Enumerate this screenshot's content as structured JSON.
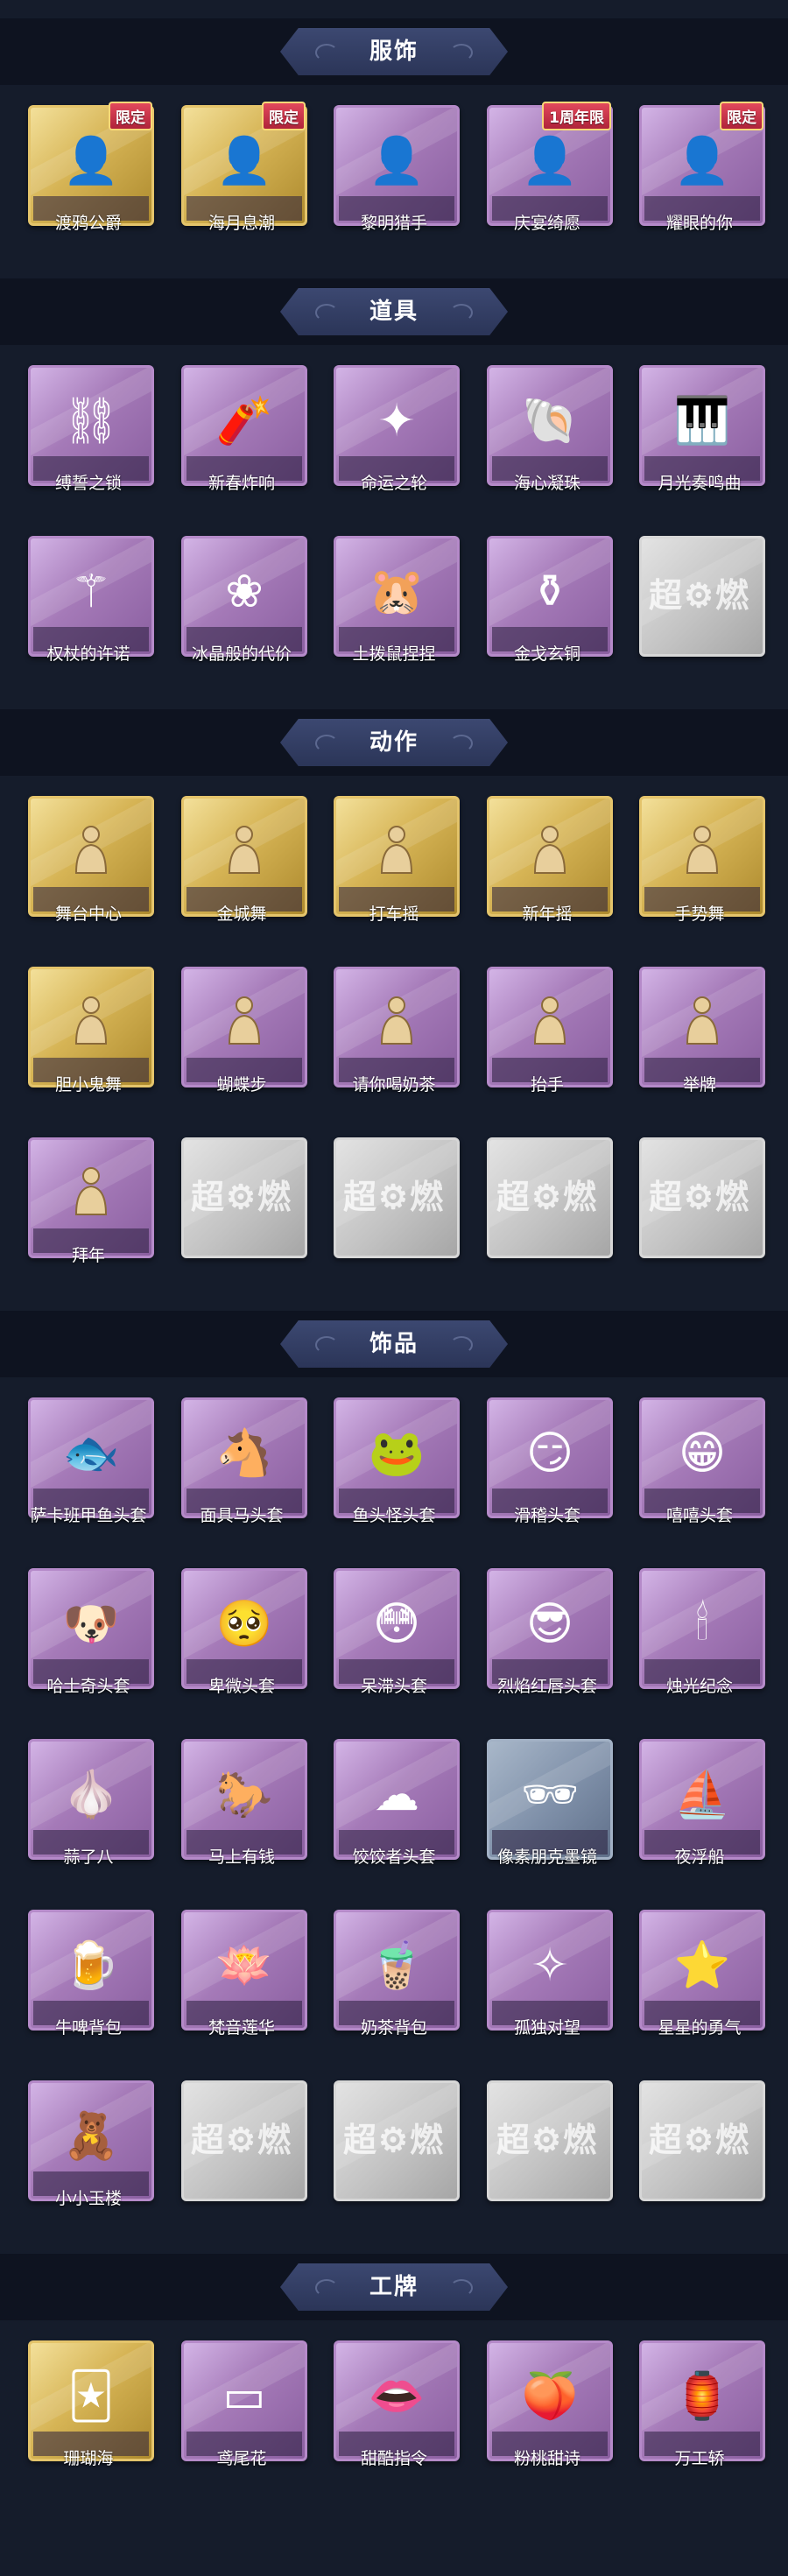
{
  "sections": [
    {
      "title": "服饰",
      "items": [
        {
          "label": "渡鸦公爵",
          "badge": "限定",
          "tier": "gold",
          "icon": "portrait-icon",
          "glyph": "👤"
        },
        {
          "label": "海月息潮",
          "badge": "限定",
          "tier": "gold",
          "icon": "portrait-icon",
          "glyph": "👤"
        },
        {
          "label": "黎明猎手",
          "badge": "",
          "tier": "purple",
          "icon": "portrait-icon",
          "glyph": "👤"
        },
        {
          "label": "庆宴绮愿",
          "badge": "1周年限",
          "tier": "purple",
          "icon": "portrait-icon",
          "glyph": "👤"
        },
        {
          "label": "耀眼的你",
          "badge": "限定",
          "tier": "purple",
          "icon": "portrait-icon",
          "glyph": "👤"
        }
      ]
    },
    {
      "title": "道具",
      "items": [
        {
          "label": "缚誓之锁",
          "badge": "",
          "tier": "purple",
          "icon": "chain-icon",
          "glyph": "⛓"
        },
        {
          "label": "新春炸响",
          "badge": "",
          "tier": "purple",
          "icon": "firecracker-icon",
          "glyph": "🧨"
        },
        {
          "label": "命运之轮",
          "badge": "",
          "tier": "purple",
          "icon": "wheel-icon",
          "glyph": "✦"
        },
        {
          "label": "海心凝珠",
          "badge": "",
          "tier": "purple",
          "icon": "pearl-icon",
          "glyph": "🐚"
        },
        {
          "label": "月光奏鸣曲",
          "badge": "",
          "tier": "purple",
          "icon": "piano-icon",
          "glyph": "🎹"
        },
        {
          "label": "权杖的许诺",
          "badge": "",
          "tier": "purple",
          "icon": "scepter-icon",
          "glyph": "⚚"
        },
        {
          "label": "冰晶般的代价",
          "badge": "",
          "tier": "purple",
          "icon": "lotus-icon",
          "glyph": "❀"
        },
        {
          "label": "土拨鼠捏捏",
          "badge": "",
          "tier": "purple",
          "icon": "hamster-icon",
          "glyph": "🐹"
        },
        {
          "label": "金戈玄铜",
          "badge": "",
          "tier": "purple",
          "icon": "bronze-icon",
          "glyph": "⚱"
        },
        {
          "label": "",
          "badge": "",
          "tier": "gray",
          "icon": "placeholder-icon",
          "glyph": ""
        }
      ]
    },
    {
      "title": "动作",
      "items": [
        {
          "label": "舞台中心",
          "badge": "",
          "tier": "gold",
          "icon": "gesture-icon",
          "glyph": ""
        },
        {
          "label": "金城舞",
          "badge": "",
          "tier": "gold",
          "icon": "gesture-icon",
          "glyph": ""
        },
        {
          "label": "打车摇",
          "badge": "",
          "tier": "gold",
          "icon": "gesture-icon",
          "glyph": ""
        },
        {
          "label": "新年摇",
          "badge": "",
          "tier": "gold",
          "icon": "gesture-icon",
          "glyph": ""
        },
        {
          "label": "手势舞",
          "badge": "",
          "tier": "gold",
          "icon": "gesture-icon",
          "glyph": ""
        },
        {
          "label": "胆小鬼舞",
          "badge": "",
          "tier": "gold",
          "icon": "gesture-icon",
          "glyph": ""
        },
        {
          "label": "蝴蝶步",
          "badge": "",
          "tier": "purple",
          "icon": "gesture-icon",
          "glyph": ""
        },
        {
          "label": "请你喝奶茶",
          "badge": "",
          "tier": "purple",
          "icon": "gesture-icon",
          "glyph": ""
        },
        {
          "label": "抬手",
          "badge": "",
          "tier": "purple",
          "icon": "gesture-icon",
          "glyph": ""
        },
        {
          "label": "举牌",
          "badge": "",
          "tier": "purple",
          "icon": "gesture-icon",
          "glyph": ""
        },
        {
          "label": "拜年",
          "badge": "",
          "tier": "purple",
          "icon": "gesture-icon",
          "glyph": ""
        },
        {
          "label": "",
          "badge": "",
          "tier": "gray",
          "icon": "placeholder-icon",
          "glyph": ""
        },
        {
          "label": "",
          "badge": "",
          "tier": "gray",
          "icon": "placeholder-icon",
          "glyph": ""
        },
        {
          "label": "",
          "badge": "",
          "tier": "gray",
          "icon": "placeholder-icon",
          "glyph": ""
        },
        {
          "label": "",
          "badge": "",
          "tier": "gray",
          "icon": "placeholder-icon",
          "glyph": ""
        }
      ]
    },
    {
      "title": "饰品",
      "items": [
        {
          "label": "萨卡班甲鱼头套",
          "badge": "",
          "tier": "purple",
          "icon": "fish-mask-icon",
          "glyph": "🐟"
        },
        {
          "label": "面具马头套",
          "badge": "",
          "tier": "purple",
          "icon": "horse-mask-icon",
          "glyph": "🐴"
        },
        {
          "label": "鱼头怪头套",
          "badge": "",
          "tier": "purple",
          "icon": "fish-monster-icon",
          "glyph": "🐸"
        },
        {
          "label": "滑稽头套",
          "badge": "",
          "tier": "purple",
          "icon": "smirk-face-icon",
          "glyph": "😏"
        },
        {
          "label": "嘻嘻头套",
          "badge": "",
          "tier": "purple",
          "icon": "grin-face-icon",
          "glyph": "😁"
        },
        {
          "label": "哈士奇头套",
          "badge": "",
          "tier": "purple",
          "icon": "dog-mask-icon",
          "glyph": "🐶"
        },
        {
          "label": "卑微头套",
          "badge": "",
          "tier": "purple",
          "icon": "sad-face-icon",
          "glyph": "🥺"
        },
        {
          "label": "呆滞头套",
          "badge": "",
          "tier": "purple",
          "icon": "blank-face-icon",
          "glyph": "😳"
        },
        {
          "label": "烈焰红唇头套",
          "badge": "",
          "tier": "purple",
          "icon": "pikachu-mask-icon",
          "glyph": "😎"
        },
        {
          "label": "烛光纪念",
          "badge": "",
          "tier": "purple",
          "icon": "candle-icon",
          "glyph": "🕯"
        },
        {
          "label": "蒜了八",
          "badge": "",
          "tier": "purple",
          "icon": "garlic-icon",
          "glyph": "🧄"
        },
        {
          "label": "马上有钱",
          "badge": "",
          "tier": "purple",
          "icon": "horse-toy-icon",
          "glyph": "🐎"
        },
        {
          "label": "饺饺者头套",
          "badge": "",
          "tier": "purple",
          "icon": "dumpling-icon",
          "glyph": "☁"
        },
        {
          "label": "像素朋克墨镜",
          "badge": "",
          "tier": "blue",
          "icon": "sunglasses-icon",
          "glyph": "🕶"
        },
        {
          "label": "夜浮船",
          "badge": "",
          "tier": "purple",
          "icon": "ghost-ship-icon",
          "glyph": "⛵"
        },
        {
          "label": "牛啤背包",
          "badge": "",
          "tier": "purple",
          "icon": "beer-backpack-icon",
          "glyph": "🍺"
        },
        {
          "label": "梵音莲华",
          "badge": "",
          "tier": "purple",
          "icon": "charm-icon",
          "glyph": "🪷"
        },
        {
          "label": "奶茶背包",
          "badge": "",
          "tier": "purple",
          "icon": "milk-tea-icon",
          "glyph": "🧋"
        },
        {
          "label": "孤独对望",
          "badge": "",
          "tier": "purple",
          "icon": "pendant-icon",
          "glyph": "✧"
        },
        {
          "label": "星星的勇气",
          "badge": "",
          "tier": "purple",
          "icon": "star-charm-icon",
          "glyph": "⭐"
        },
        {
          "label": "小小玉楼",
          "badge": "",
          "tier": "purple",
          "icon": "doll-icon",
          "glyph": "🧸"
        },
        {
          "label": "",
          "badge": "",
          "tier": "gray",
          "icon": "placeholder-icon",
          "glyph": ""
        },
        {
          "label": "",
          "badge": "",
          "tier": "gray",
          "icon": "placeholder-icon",
          "glyph": ""
        },
        {
          "label": "",
          "badge": "",
          "tier": "gray",
          "icon": "placeholder-icon",
          "glyph": ""
        },
        {
          "label": "",
          "badge": "",
          "tier": "gray",
          "icon": "placeholder-icon",
          "glyph": ""
        }
      ]
    },
    {
      "title": "工牌",
      "items": [
        {
          "label": "珊瑚海",
          "badge": "",
          "tier": "gold",
          "icon": "badge-card-icon",
          "glyph": "🃏"
        },
        {
          "label": "鸢尾花",
          "badge": "",
          "tier": "purple",
          "icon": "badge-card-icon",
          "glyph": "▭"
        },
        {
          "label": "甜酷指令",
          "badge": "",
          "tier": "purple",
          "icon": "badge-card-icon",
          "glyph": "👄"
        },
        {
          "label": "粉桃甜诗",
          "badge": "",
          "tier": "purple",
          "icon": "badge-card-icon",
          "glyph": "🍑"
        },
        {
          "label": "万工轿",
          "badge": "",
          "tier": "purple",
          "icon": "badge-card-icon",
          "glyph": "🏮"
        }
      ]
    }
  ]
}
